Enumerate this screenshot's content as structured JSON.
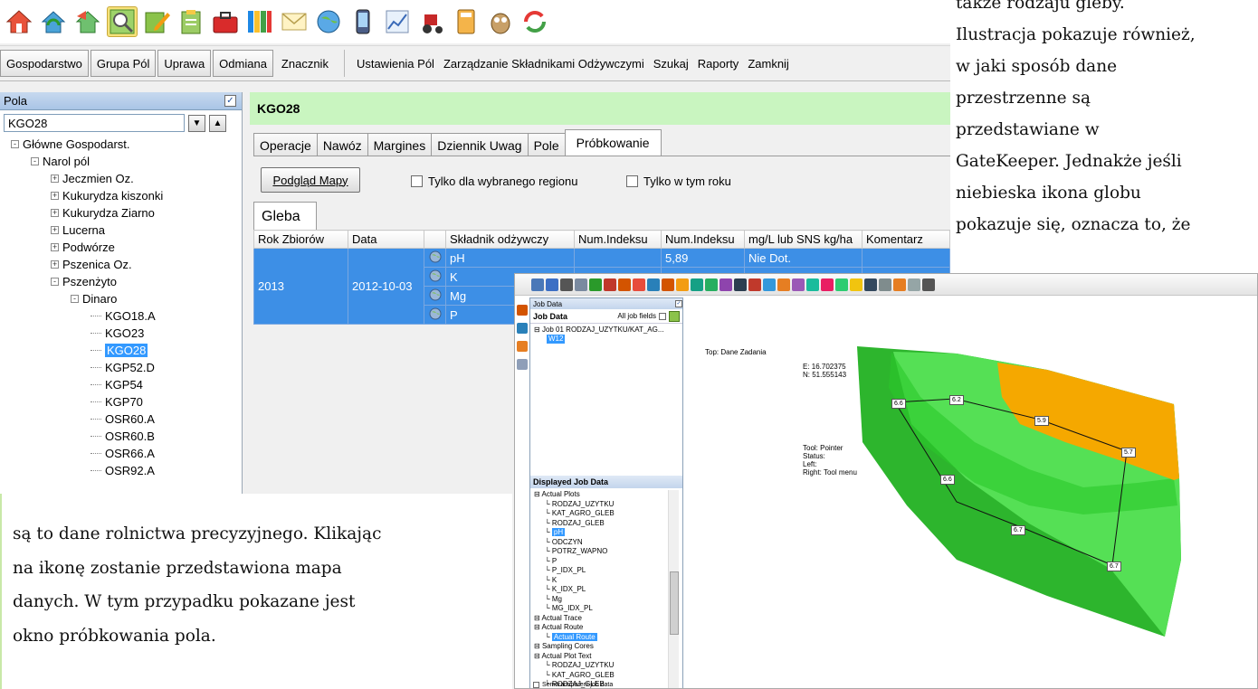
{
  "menu": {
    "left_buttons": [
      "Gospodarstwo",
      "Grupa Pól",
      "Uprawa",
      "Odmiana",
      "Znacznik"
    ],
    "right_items": [
      "Ustawienia Pól",
      "Zarządzanie Składnikami Odżywczymi",
      "Szukaj",
      "Raporty",
      "Zamknij"
    ]
  },
  "toolbar_icons": [
    "home-icon",
    "refresh-home-icon",
    "home-arrow-icon",
    "zoom-map-icon",
    "edit-icon",
    "clipboard-icon",
    "toolbox-icon",
    "columns-icon",
    "mail-icon",
    "globe-icon",
    "phone-icon",
    "chart-icon",
    "tractor-icon",
    "calculator-icon",
    "owl-icon",
    "sync-icon"
  ],
  "pola": {
    "title": "Pola",
    "search_value": "KGO28",
    "tree": [
      {
        "label": "Główne Gospodarst.",
        "level": 0,
        "exp": "-"
      },
      {
        "label": "Narol pól",
        "level": 1,
        "exp": "-"
      },
      {
        "label": "Jeczmien Oz.",
        "level": 2,
        "exp": "+"
      },
      {
        "label": "Kukurydza kiszonki",
        "level": 2,
        "exp": "+"
      },
      {
        "label": "Kukurydza Ziarno",
        "level": 2,
        "exp": "+"
      },
      {
        "label": "Lucerna",
        "level": 2,
        "exp": "+"
      },
      {
        "label": "Podwórze",
        "level": 2,
        "exp": "+"
      },
      {
        "label": "Pszenica Oz.",
        "level": 2,
        "exp": "+"
      },
      {
        "label": "Pszenżyto",
        "level": 2,
        "exp": "-"
      },
      {
        "label": "Dinaro",
        "level": 3,
        "exp": "-"
      },
      {
        "label": "KGO18.A",
        "level": 4,
        "exp": ""
      },
      {
        "label": "KGO23",
        "level": 4,
        "exp": ""
      },
      {
        "label": "KGO28",
        "level": 4,
        "exp": "",
        "selected": true
      },
      {
        "label": "KGP52.D",
        "level": 4,
        "exp": ""
      },
      {
        "label": "KGP54",
        "level": 4,
        "exp": ""
      },
      {
        "label": "KGP70",
        "level": 4,
        "exp": ""
      },
      {
        "label": "OSR60.A",
        "level": 4,
        "exp": ""
      },
      {
        "label": "OSR60.B",
        "level": 4,
        "exp": ""
      },
      {
        "label": "OSR66.A",
        "level": 4,
        "exp": ""
      },
      {
        "label": "OSR92.A",
        "level": 4,
        "exp": ""
      }
    ]
  },
  "field": {
    "title": "KGO28",
    "tabs": [
      "Operacje",
      "Nawóz",
      "Margines",
      "Dziennik Uwag",
      "Pole",
      "Próbkowanie"
    ],
    "active_tab": "Próbkowanie",
    "map_button": "Podgląd Mapy",
    "chk_region": "Tylko dla wybranego regionu",
    "chk_year": "Tylko w tym roku",
    "sub_tab": "Gleba",
    "columns": [
      "Rok Zbiorów",
      "Data",
      "",
      "Składnik odżywczy",
      "Num.Indeksu",
      "Num.Indeksu",
      "mg/L lub SNS kg/ha",
      "Komentarz"
    ],
    "rows": [
      {
        "year": "2013",
        "date": "2012-10-03",
        "nutrient": "pH",
        "idx1": "",
        "idx2": "5,89",
        "value": "Nie Dot.",
        "comment": ""
      },
      {
        "year": "",
        "date": "",
        "nutrient": "K",
        "idx1": "",
        "idx2": "",
        "value": "",
        "comment": ""
      },
      {
        "year": "",
        "date": "",
        "nutrient": "Mg",
        "idx1": "",
        "idx2": "",
        "value": "",
        "comment": ""
      },
      {
        "year": "",
        "date": "",
        "nutrient": "P",
        "idx1": "",
        "idx2": "",
        "value": "",
        "comment": ""
      }
    ]
  },
  "job_window": {
    "caption": "Job Data",
    "panel_title": "Job Data",
    "all_fields": "All job fields",
    "job_tree": [
      "Job 01 RODZAJ_UZYTKU/KAT_AG...",
      "W12"
    ],
    "displayed_title": "Displayed Job Data",
    "displayed_tree": [
      {
        "t": "Actual Plots",
        "lvl": 0
      },
      {
        "t": "RODZAJ_UZYTKU",
        "lvl": 1
      },
      {
        "t": "KAT_AGRO_GLEB",
        "lvl": 1
      },
      {
        "t": "RODZAJ_GLEB",
        "lvl": 1
      },
      {
        "t": "pH",
        "lvl": 1,
        "hl": true
      },
      {
        "t": "ODCZYN",
        "lvl": 1
      },
      {
        "t": "POTRZ_WAPNO",
        "lvl": 1
      },
      {
        "t": "P",
        "lvl": 1
      },
      {
        "t": "P_IDX_PL",
        "lvl": 1
      },
      {
        "t": "K",
        "lvl": 1
      },
      {
        "t": "K_IDX_PL",
        "lvl": 1
      },
      {
        "t": "Mg",
        "lvl": 1
      },
      {
        "t": "MG_IDX_PL",
        "lvl": 1
      },
      {
        "t": "Actual Trace",
        "lvl": 0
      },
      {
        "t": "Actual Route",
        "lvl": 0
      },
      {
        "t": "Actual Route",
        "lvl": 1,
        "hl": true
      },
      {
        "t": "Sampling Cores",
        "lvl": 0
      },
      {
        "t": "Actual Plot Text",
        "lvl": 0
      },
      {
        "t": "RODZAJ_UZYTKU",
        "lvl": 1
      },
      {
        "t": "KAT_AGRO_GLEB",
        "lvl": 1
      },
      {
        "t": "RODZAJ_GLEB",
        "lvl": 1
      }
    ],
    "bottom_text": "Semitransparent job data",
    "map_title": "Top: Dane Zadania",
    "coords": "E: 16.702375\nN: 51.555143",
    "status": "Tool: Pointer\nStatus:\nLeft:\nRight: Tool menu",
    "point_labels": [
      "6.6",
      "6.2",
      "5.9",
      "5.7",
      "6.6",
      "6.7",
      "6.7"
    ],
    "colors": {
      "dark_green": "#2db52d",
      "mid_green": "#22cc22",
      "light_green": "#55e055",
      "orange": "#f5a800"
    }
  },
  "doc": {
    "right_lines": [
      "także rodzaju gleby.",
      "Ilustracja pokazuje również,",
      "w jaki sposób dane",
      "przestrzenne są",
      "przedstawiane w",
      "GateKeeper. Jednakże jeśli",
      "niebieska ikona globu",
      "pokazuje się, oznacza to, że"
    ],
    "left_lines": [
      "są to dane rolnictwa precyzyjnego. Klikając",
      "na ikonę zostanie przedstawiona mapa",
      "danych. W tym przypadku pokazane jest",
      "okno próbkowania pola."
    ]
  }
}
